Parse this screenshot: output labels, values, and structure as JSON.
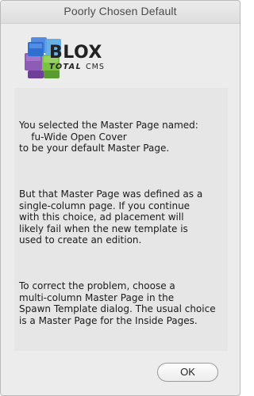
{
  "window": {
    "title": "Poorly Chosen Default"
  },
  "logo": {
    "brand": "BLOX",
    "tagline_total": "TOTAL",
    "tagline_cms": "CMS",
    "icon": "blox-cubes-logo"
  },
  "message": {
    "paragraph1": "You selected the Master Page named:\n    fu-Wide Open Cover\nto be your default Master Page.",
    "paragraph2": "But that Master Page was defined as a\nsingle-column page. If you continue\nwith this choice, ad placement will\nlikely fail when the new template is\nused to create an edition.",
    "paragraph3": "To correct the problem, choose a\nmulti-column Master Page in the\nSpawn Template dialog. The usual choice\nis a Master Page for the Inside Pages."
  },
  "buttons": {
    "ok_label": "OK"
  },
  "colors": {
    "window_bg": "#ececec",
    "panel_bg": "#e6e6e6",
    "cube_blue": "#2f6fd0",
    "cube_green": "#7cc242",
    "cube_purple": "#8e5bb6",
    "cube_light_blue": "#5aa9e6"
  }
}
